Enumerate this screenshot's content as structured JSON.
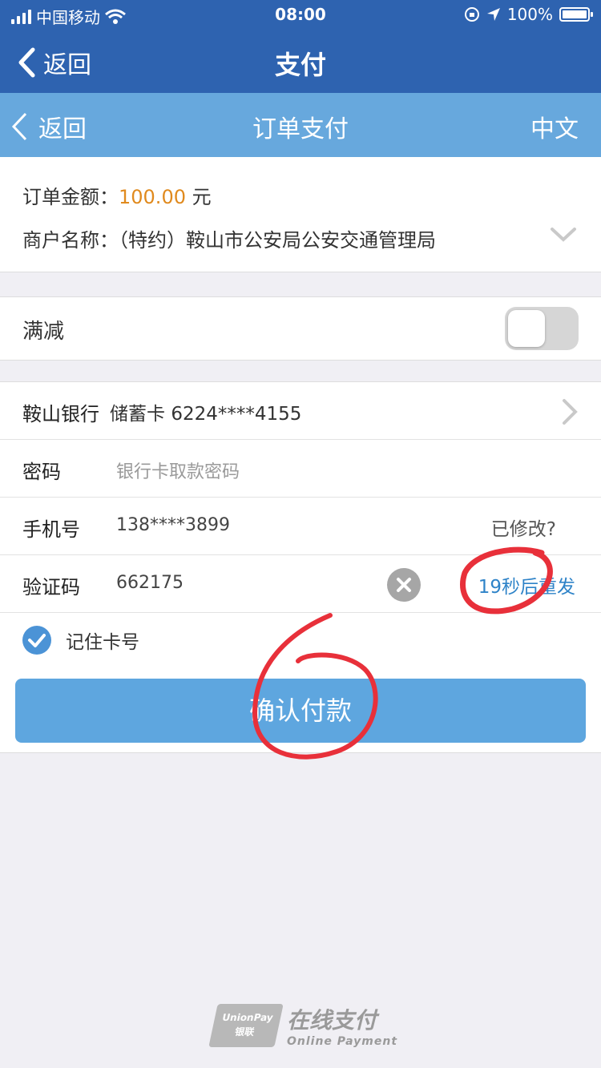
{
  "status_bar": {
    "carrier": "中国移动",
    "time": "08:00",
    "battery": "100%"
  },
  "app_nav": {
    "back_label": "返回",
    "title": "支付"
  },
  "payment_nav": {
    "back_label": "返回",
    "title": "订单支付",
    "language": "中文"
  },
  "order": {
    "amount_label": "订单金额：",
    "amount_value": "100.00",
    "amount_unit": "元",
    "merchant_label": "商户名称：",
    "merchant_value": "（特约）鞍山市公安局公安交通管理局"
  },
  "discount": {
    "label": "满减",
    "toggle_on": false
  },
  "card": {
    "bank": "鞍山银行",
    "type": "储蓄卡",
    "number": "6224****4155"
  },
  "password": {
    "label": "密码",
    "placeholder": "银行卡取款密码"
  },
  "phone": {
    "label": "手机号",
    "value": "138****3899",
    "modified_link": "已修改?"
  },
  "verify": {
    "label": "验证码",
    "value": "662175",
    "resend": "19秒后重发"
  },
  "remember": {
    "label": "记住卡号",
    "checked": true
  },
  "confirm_button": "确认付款",
  "annotation": {
    "number": "6"
  },
  "footer": {
    "logo_text_top": "UnionPay",
    "logo_text_bottom": "银联",
    "title": "在线支付",
    "subtitle": "Online Payment"
  },
  "colors": {
    "app_nav": "#2e63b0",
    "payment_nav": "#67a8dd",
    "accent": "#5ea6df",
    "amount": "#e08a1e",
    "annotation": "#e8303a"
  }
}
